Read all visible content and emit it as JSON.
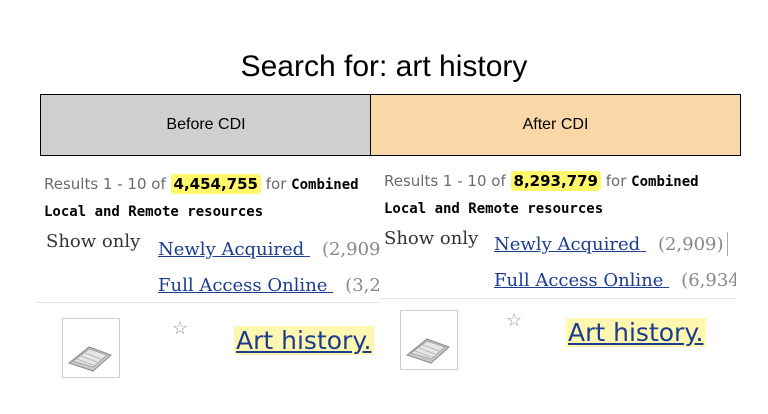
{
  "title": "Search for:  art history",
  "headers": {
    "before": "Before CDI",
    "after": "After CDI"
  },
  "before": {
    "results_prefix": "Results 1 - 10 of ",
    "count": "4,454,755",
    "for": " for ",
    "combined": "Combined",
    "line2": "Local and Remote resources",
    "show_only": "Show only",
    "newly_label": "Newly Acquired",
    "newly_count": "(2,909)",
    "full_label": "Full Access Online",
    "full_count": "(3,2",
    "item_title": "Art history."
  },
  "after": {
    "results_prefix": "Results 1 - 10 of ",
    "count": "8,293,779",
    "for": " for ",
    "combined": "Combined",
    "line2": "Local and Remote resources",
    "show_only": "Show only",
    "newly_label": "Newly Acquired",
    "newly_count": "(2,909)",
    "full_label": "Full Access Online",
    "full_count": "(6,934,",
    "item_title": "Art history."
  },
  "icons": {
    "star": "star-icon",
    "thumb": "book-thumbnail-icon"
  },
  "colors": {
    "before_header": "#cfcfcf",
    "after_header": "#fad7a7",
    "highlight": "#fff86a",
    "link": "#1a3d8f"
  }
}
